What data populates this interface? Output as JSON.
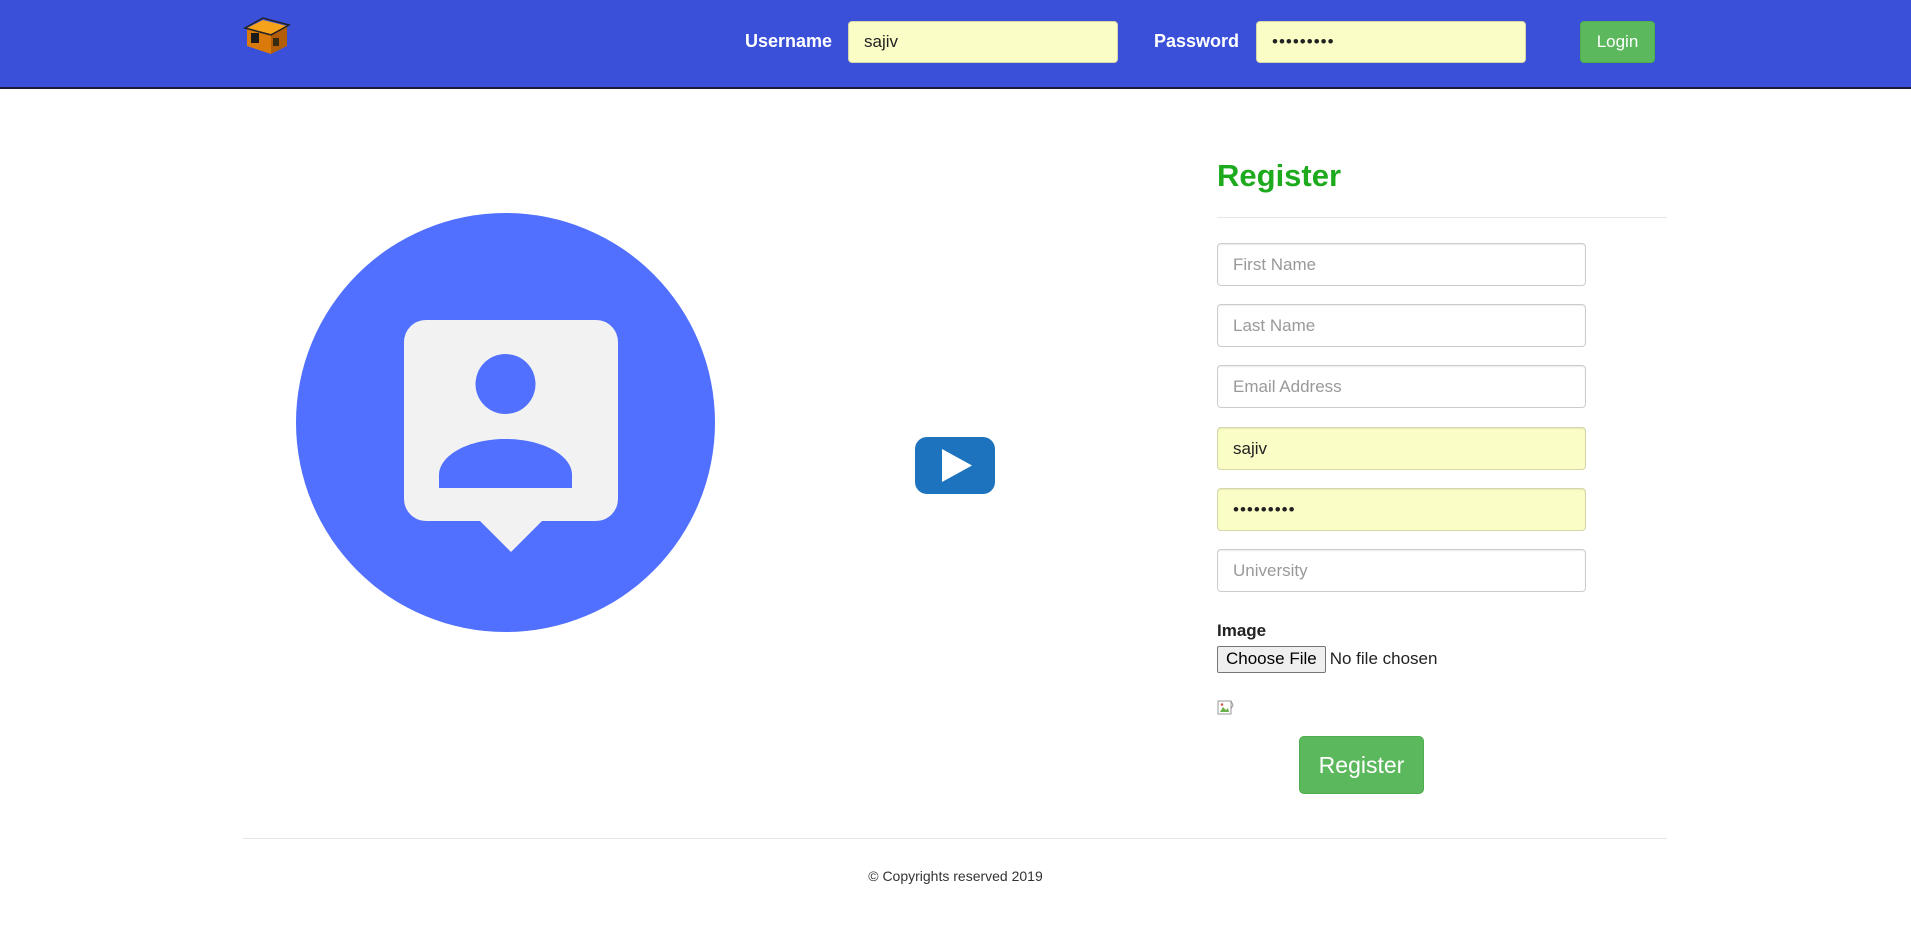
{
  "header": {
    "username_label": "Username",
    "username_value": "sajiv",
    "password_label": "Password",
    "password_value": "•••••••••",
    "login_label": "Login",
    "colors": {
      "bar": "#3a50d9",
      "login": "#5cb85c",
      "autofill": "#fbfdc6"
    }
  },
  "illustration": {
    "icon": "contact-avatar-icon",
    "color": "#5170ff"
  },
  "video": {
    "icon": "youtube-play-icon",
    "color": "#1e73be"
  },
  "register": {
    "title": "Register",
    "title_color": "#1dab1d",
    "fields": {
      "first_name_placeholder": "First Name",
      "last_name_placeholder": "Last Name",
      "email_placeholder": "Email Address",
      "username_value": "sajiv",
      "password_value": "•••••••••",
      "university_placeholder": "University"
    },
    "image_label": "Image",
    "file_button_label": "Choose File",
    "file_status": "No file chosen",
    "submit_label": "Register"
  },
  "footer": {
    "text": "© Copyrights reserved 2019"
  }
}
